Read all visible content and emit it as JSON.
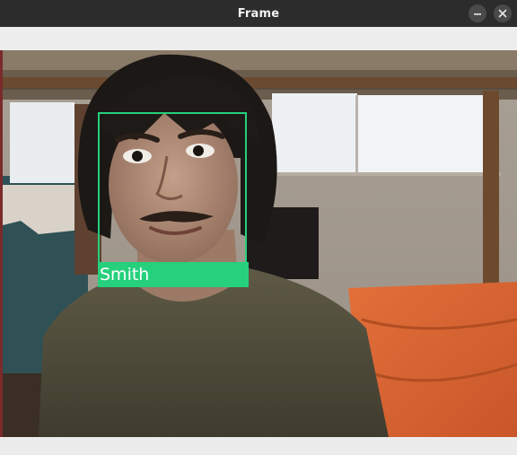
{
  "window": {
    "title": "Frame",
    "minimize_icon": "minimize-icon",
    "close_icon": "close-icon"
  },
  "detection": {
    "label": "Smith",
    "box_color": "#26d07c"
  },
  "colors": {
    "titlebar": "#2c2c2c",
    "title_text": "#f2f2f2",
    "chrome": "#ececec"
  }
}
